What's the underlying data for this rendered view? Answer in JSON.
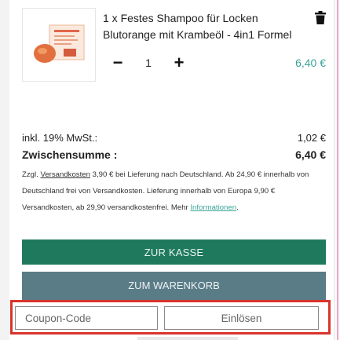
{
  "cart_item": {
    "title": "1 x Festes Shampoo für Locken Blutorange mit Krambeöl - 4in1 Formel",
    "quantity": "1",
    "minus_label": "−",
    "plus_label": "+",
    "price": "6,40 €"
  },
  "summary": {
    "tax_label": "inkl. 19% MwSt.:",
    "tax_value": "1,02 €",
    "subtotal_label": "Zwischensumme :",
    "subtotal_value": "6,40 €"
  },
  "shipping": {
    "prefix": "Zzgl. ",
    "link_label": "Versandkosten",
    "text": " 3,90 € bei Lieferung nach Deutschland. Ab 24,90 € innerhalb von Deutschland frei von Versandkosten. Lieferung innerhalb von Europa 9,90 € Versandkosten, ab 29,90 versandkostenfrei. Mehr ",
    "info_link_label": "Informationen",
    "suffix": "."
  },
  "buttons": {
    "checkout_label": "ZUR KASSE",
    "cart_label": "ZUM WARENKORB"
  },
  "coupon": {
    "placeholder": "Coupon-Code",
    "redeem_label": "Einlösen"
  },
  "colors": {
    "price_teal": "#3aa597",
    "checkout_green": "#1f7a5d",
    "cart_slate": "#5a7c87",
    "highlight_red": "#d9342b"
  }
}
